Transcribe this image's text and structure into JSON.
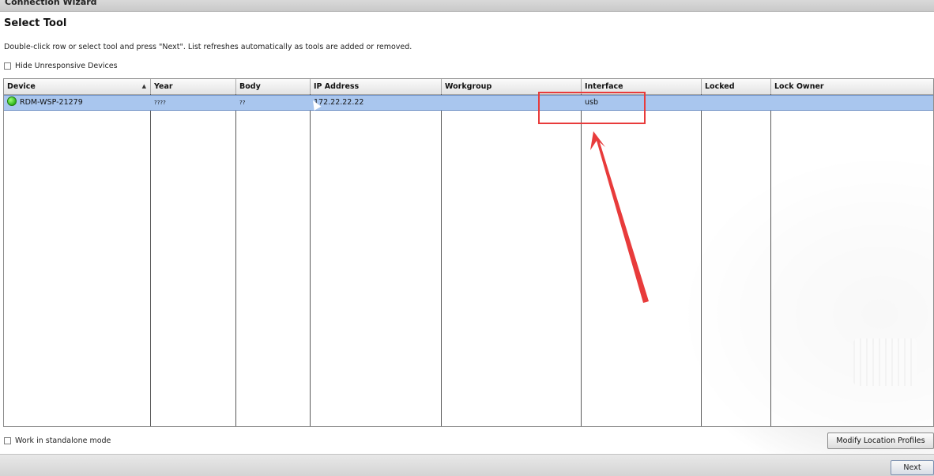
{
  "window": {
    "title": "Connection Wizard"
  },
  "page": {
    "heading": "Select Tool",
    "instructions": "Double-click row or select tool and press \"Next\".  List refreshes automatically as tools are added or removed."
  },
  "options": {
    "hide_unresponsive_label": "Hide Unresponsive Devices",
    "standalone_label": "Work in standalone mode"
  },
  "table": {
    "columns": [
      "Device",
      "Year",
      "Body",
      "IP Address",
      "Workgroup",
      "Interface",
      "Locked",
      "Lock Owner"
    ],
    "sort_indicator": "▲",
    "rows": [
      {
        "device": "RDM-WSP-21279",
        "year": "????",
        "body": "??",
        "ip_address": "172.22.22.22",
        "workgroup": "",
        "interface": "usb",
        "locked": "",
        "lock_owner": ""
      }
    ]
  },
  "buttons": {
    "modify_location_profiles": "Modify Location Profiles",
    "next": "Next"
  },
  "annotation": {
    "color": "#e83b3b"
  }
}
